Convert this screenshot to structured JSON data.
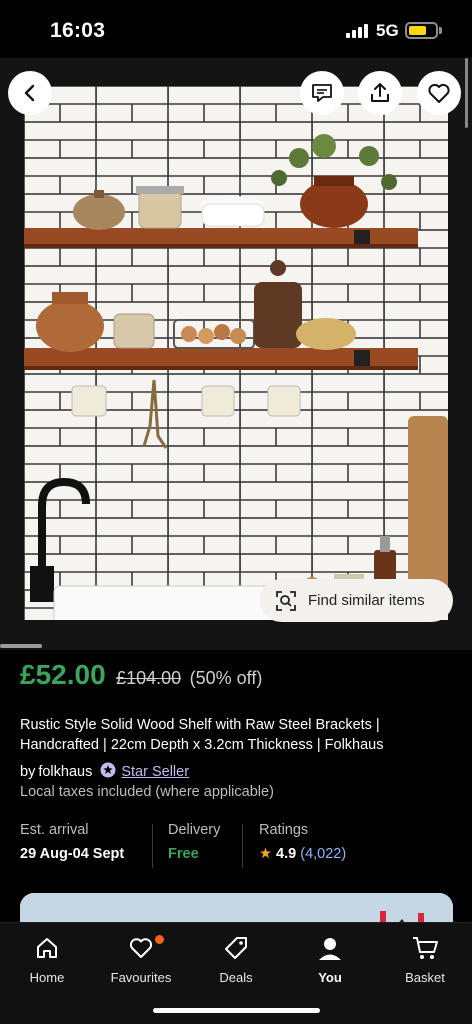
{
  "status_bar": {
    "time": "16:03",
    "network": "5G"
  },
  "listing": {
    "price": "£52.00",
    "original_price": "£104.00",
    "discount": "(50% off)",
    "title": "Rustic Style Solid Wood Shelf with Raw Steel Brackets | Handcrafted | 22cm Depth x 3.2cm Thickness | Folkhaus",
    "seller_prefix": "by",
    "seller_name": "folkhaus",
    "star_seller_label": "Star Seller",
    "tax_note": "Local taxes included (where applicable)"
  },
  "find_similar_label": "Find similar items",
  "info": {
    "arrival_label": "Est. arrival",
    "arrival_value": "29 Aug-04 Sept",
    "delivery_label": "Delivery",
    "delivery_value": "Free",
    "ratings_label": "Ratings",
    "rating_star": "★",
    "rating_value": "4.9",
    "rating_count": "(4,022)"
  },
  "tabs": [
    {
      "label": "Home",
      "icon": "home-icon"
    },
    {
      "label": "Favourites",
      "icon": "heart-icon"
    },
    {
      "label": "Deals",
      "icon": "tag-icon"
    },
    {
      "label": "You",
      "icon": "person-icon"
    },
    {
      "label": "Basket",
      "icon": "basket-icon"
    }
  ],
  "colors": {
    "price_green": "#3aa55d",
    "star_seller_purple": "#c9b8f0",
    "notification_dot": "#f1641e",
    "battery_yellow": "#ffd60a"
  }
}
